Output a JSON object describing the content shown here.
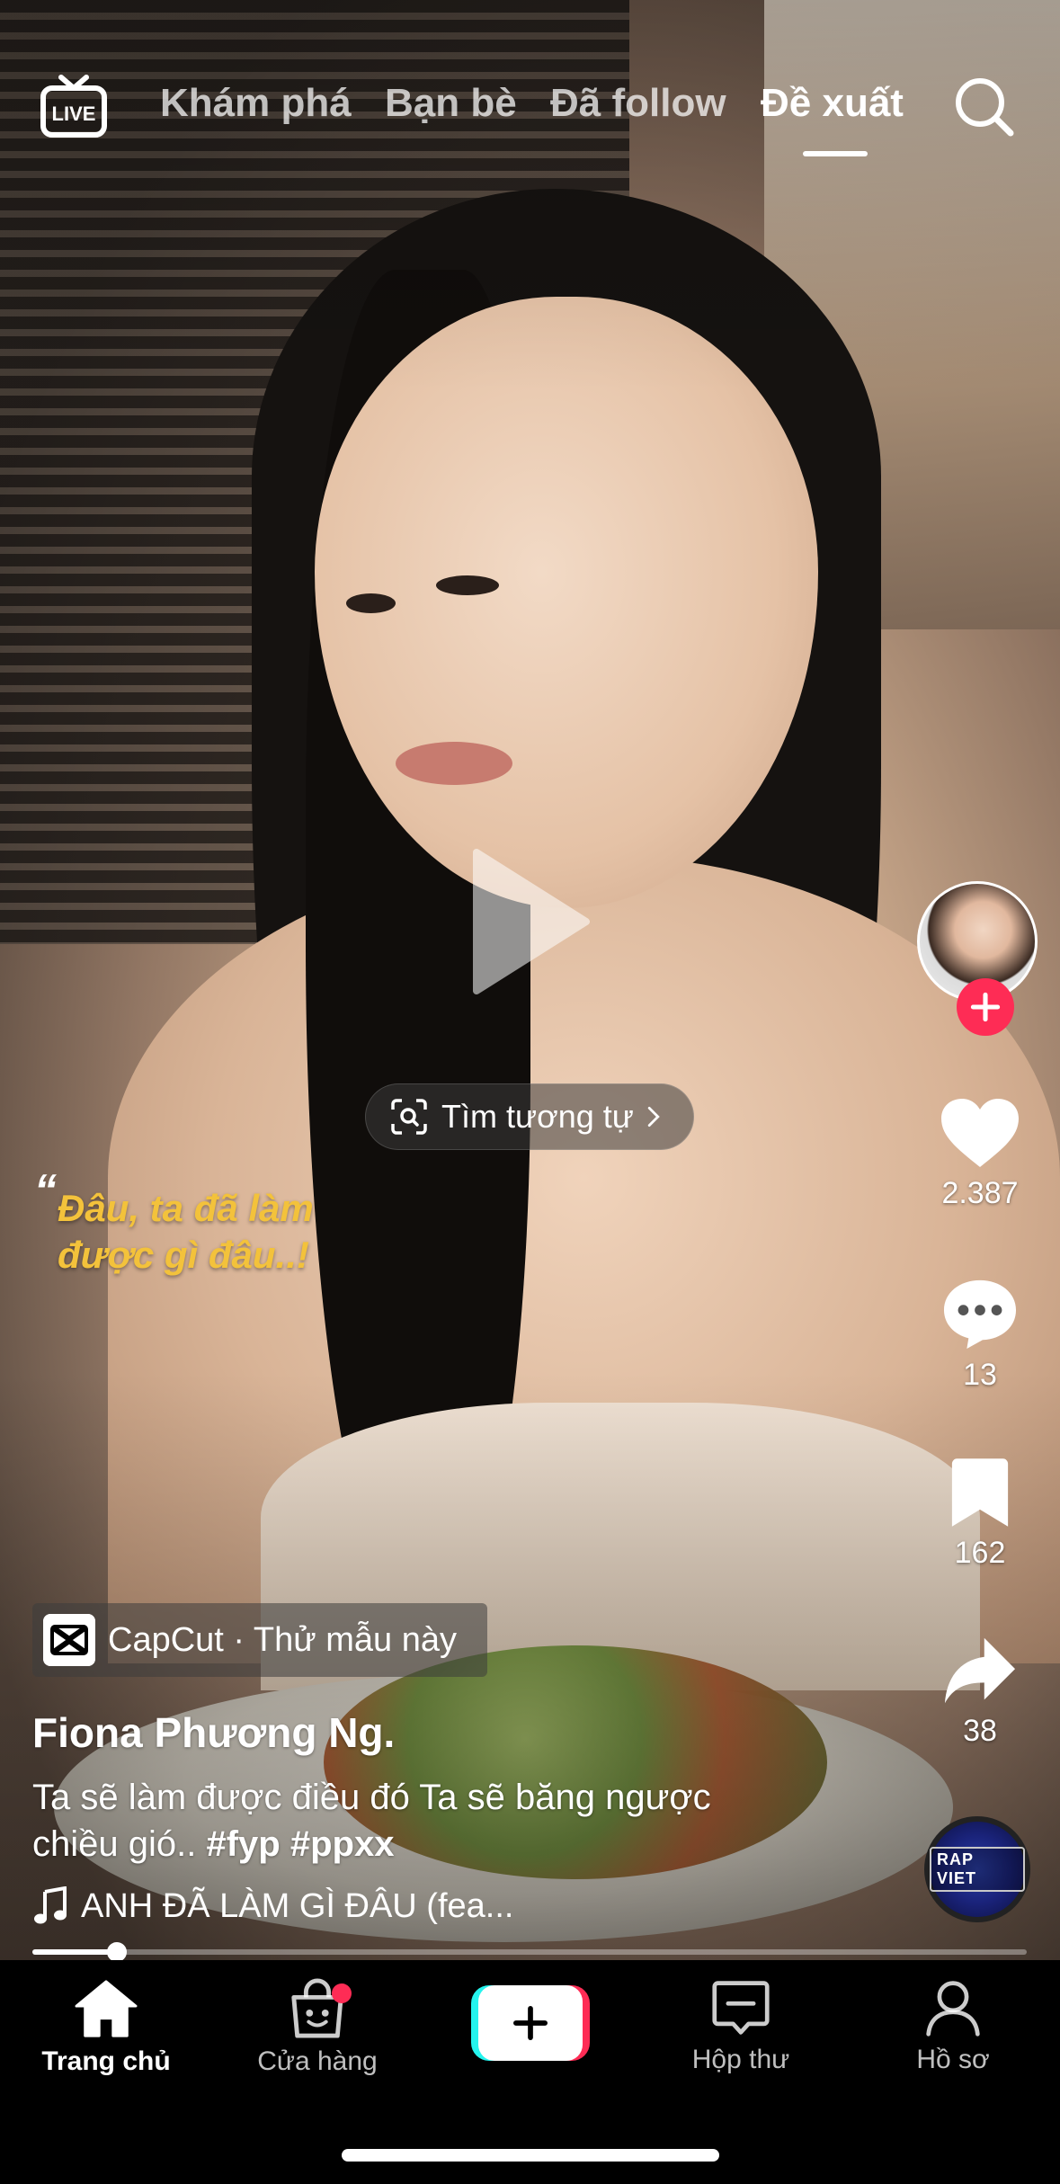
{
  "top_nav": {
    "live_label": "LIVE",
    "tabs": [
      {
        "label": "Khám phá",
        "active": false
      },
      {
        "label": "Bạn bè",
        "active": false
      },
      {
        "label": "Đã follow",
        "active": false
      },
      {
        "label": "Đề xuất",
        "active": true
      }
    ],
    "search_icon": "search-icon"
  },
  "video": {
    "overlay_quote_mark": "“",
    "overlay_quote": "Đâu, ta đã làm được gì đâu..!",
    "overlay_quote_color": "#f3c23b",
    "play_icon": "play-icon",
    "find_similar_label": "Tìm tương tự"
  },
  "rail": {
    "follow_icon": "plus-icon",
    "likes": "2.387",
    "comments": "13",
    "saves": "162",
    "shares": "38",
    "music_disc_text": "RAP VIET"
  },
  "info": {
    "template_chip": "CapCut · Thử mẫu này",
    "username": "Fiona Phương Ng.",
    "caption_text": "Ta sẽ làm được điều đó Ta sẽ băng ngược chiều gió..",
    "hashtags": [
      "#fyp",
      "#ppxx"
    ],
    "music": "ANH ĐÃ LÀM GÌ ĐÂU (fea..."
  },
  "progress": {
    "fraction": 0.085
  },
  "bottom_nav": {
    "items": [
      {
        "label": "Trang chủ",
        "icon": "home-icon",
        "active": true
      },
      {
        "label": "Cửa hàng",
        "icon": "shop-bag-icon",
        "active": false,
        "badge": true
      },
      {
        "label": "",
        "icon": "create-plus-icon",
        "active": false
      },
      {
        "label": "Hộp thư",
        "icon": "inbox-icon",
        "active": false
      },
      {
        "label": "Hồ sơ",
        "icon": "profile-icon",
        "active": false
      }
    ]
  },
  "colors": {
    "accent": "#fe2c55",
    "cyan": "#25f4ee"
  }
}
